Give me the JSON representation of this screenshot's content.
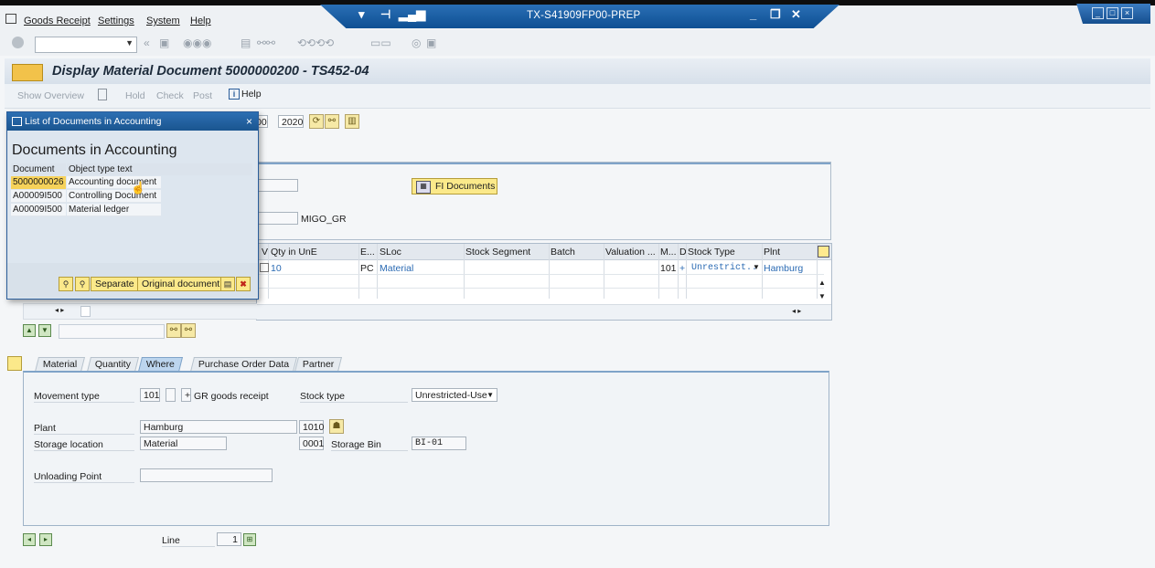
{
  "menu": [
    "Goods Receipt",
    "Settings",
    "System",
    "Help"
  ],
  "window": {
    "title": "TX-S41909FP00-PREP"
  },
  "page_title": "Display Material Document 5000000200 - TS452-04",
  "app_toolbar": {
    "show_overview": "Show Overview",
    "hold": "Hold",
    "check": "Check",
    "post": "Post",
    "help": "Help"
  },
  "header": {
    "doc_fragment": "00",
    "year": "2020",
    "fi_documents": "FI Documents",
    "migo_label": "MIGO_GR"
  },
  "items": {
    "columns": [
      "V",
      "Qty in UnE",
      "E...",
      "SLoc",
      "Stock Segment",
      "Batch",
      "Valuation ...",
      "M...",
      "D",
      "Stock Type",
      "Plnt"
    ],
    "row": {
      "qty": "10",
      "unit": "PC",
      "sloc": "Material",
      "mvt": "101",
      "d": "+",
      "stock_type": "Unrestrict..",
      "plant": "Hamburg"
    }
  },
  "tabs": [
    "Material",
    "Quantity",
    "Where",
    "Purchase Order Data",
    "Partner"
  ],
  "where": {
    "movement_type_label": "Movement type",
    "movement_type": "101",
    "movement_sign": "+",
    "movement_desc": "GR goods receipt",
    "stock_type_label": "Stock type",
    "stock_type": "Unrestricted-Use",
    "plant_label": "Plant",
    "plant": "Hamburg",
    "plant_code": "1010",
    "storage_location_label": "Storage location",
    "storage_location": "Material",
    "storage_location_code": "0001",
    "storage_bin_label": "Storage Bin",
    "storage_bin": "BI-01",
    "unloading_point_label": "Unloading Point",
    "unloading_point": ""
  },
  "footer": {
    "line_label": "Line",
    "line_value": "1"
  },
  "dialog": {
    "title": "List of Documents in Accounting",
    "heading": "Documents in Accounting",
    "col_document": "Document",
    "col_type": "Object type text",
    "rows": [
      {
        "document": "5000000026",
        "type": "Accounting document"
      },
      {
        "document": "A00009I500",
        "type": "Controlling Document"
      },
      {
        "document": "A00009I500",
        "type": "Material ledger"
      }
    ],
    "separate": "Separate",
    "original": "Original document"
  }
}
